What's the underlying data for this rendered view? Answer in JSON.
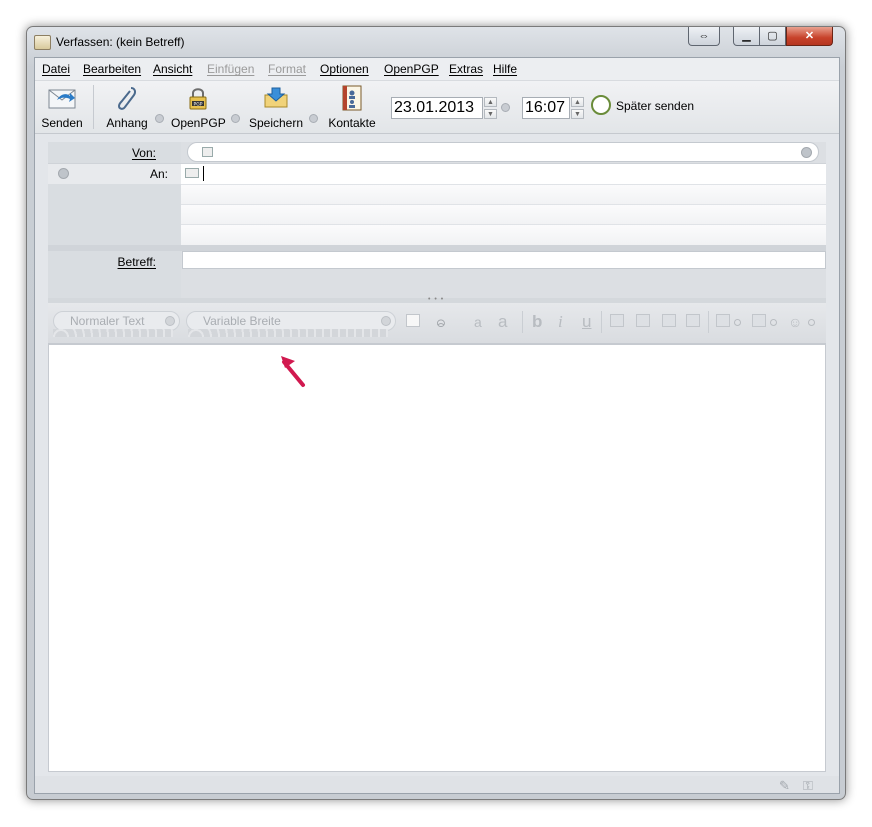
{
  "window": {
    "title": "Verfassen: (kein Betreff)"
  },
  "menu": [
    {
      "label": "Datei",
      "disabled": false
    },
    {
      "label": "Bearbeiten",
      "disabled": false
    },
    {
      "label": "Ansicht",
      "disabled": false
    },
    {
      "label": "Einfügen",
      "disabled": true
    },
    {
      "label": "Format",
      "disabled": true
    },
    {
      "label": "Optionen",
      "disabled": false
    },
    {
      "label": "OpenPGP",
      "disabled": false
    },
    {
      "label": "Extras",
      "disabled": false
    },
    {
      "label": "Hilfe",
      "disabled": false
    }
  ],
  "toolbar": {
    "send": "Senden",
    "attach": "Anhang",
    "openpgp": "OpenPGP",
    "save": "Speichern",
    "contacts": "Kontakte",
    "date": "23.01.2013",
    "time": "16:07",
    "send_later": "Später senden"
  },
  "header": {
    "from_label": "Von:",
    "from_value": "",
    "to_label": "An:",
    "subject_label": "Betreff:"
  },
  "format": {
    "paragraph": "Normaler Text",
    "font": "Variable Breite"
  },
  "colors": {
    "annotation_arrow": "#d1194f",
    "close_button": "#c7422a"
  }
}
